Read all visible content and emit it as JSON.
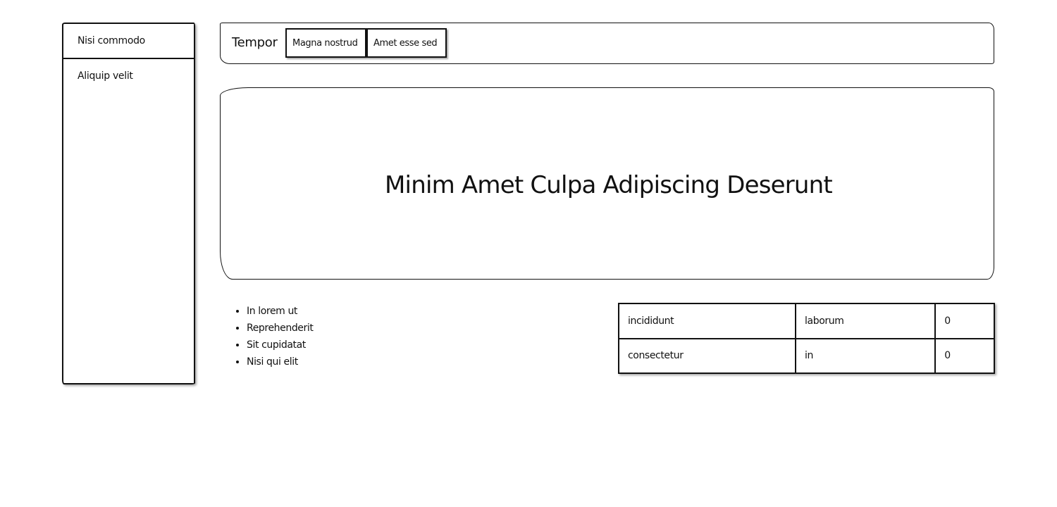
{
  "sidebar": {
    "items": [
      {
        "label": "Nisi commodo"
      },
      {
        "label": "Aliquip velit"
      }
    ]
  },
  "topnav": {
    "brand": "Tempor",
    "buttons": [
      {
        "label": "Magna nostrud"
      },
      {
        "label": "Amet esse sed"
      }
    ]
  },
  "hero": {
    "title": "Minim Amet Culpa Adipiscing Deserunt"
  },
  "list": {
    "items": [
      "In lorem ut",
      "Reprehenderit",
      "Sit cupidatat",
      "Nisi qui elit"
    ]
  },
  "table": {
    "rows": [
      [
        "incididunt",
        "laborum",
        "0"
      ],
      [
        "consectetur",
        "in",
        "0"
      ]
    ]
  }
}
